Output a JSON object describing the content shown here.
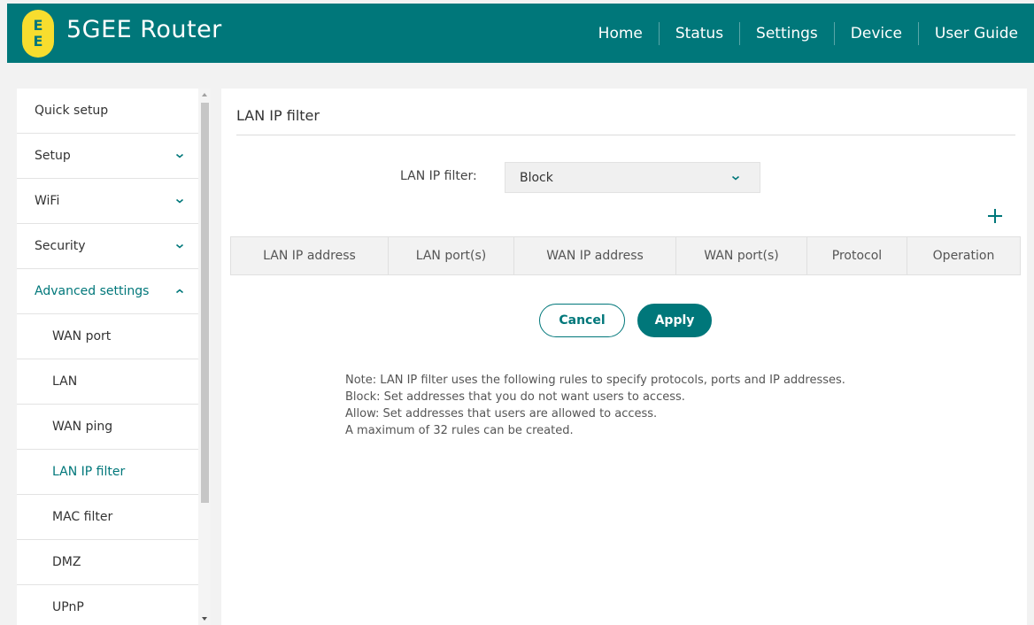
{
  "header": {
    "logo_top": "E",
    "logo_bottom": "E",
    "brand": "5GEE Router",
    "nav": [
      "Home",
      "Status",
      "Settings",
      "Device",
      "User Guide"
    ]
  },
  "sidebar": {
    "items": [
      {
        "label": "Quick setup",
        "chevron": ""
      },
      {
        "label": "Setup",
        "chevron": "chevron-down"
      },
      {
        "label": "WiFi",
        "chevron": "chevron-down"
      },
      {
        "label": "Security",
        "chevron": "chevron-down"
      },
      {
        "label": "Advanced settings",
        "chevron": "chevron-up"
      }
    ],
    "subitems": [
      {
        "label": "WAN port"
      },
      {
        "label": "LAN"
      },
      {
        "label": "WAN ping"
      },
      {
        "label": "LAN IP filter"
      },
      {
        "label": "MAC filter"
      },
      {
        "label": "DMZ"
      },
      {
        "label": "UPnP"
      }
    ],
    "active_subitem": "LAN IP filter"
  },
  "main": {
    "title": "LAN IP filter",
    "filter_label": "LAN IP filter:",
    "filter_value": "Block",
    "table": {
      "columns": [
        "LAN IP address",
        "LAN port(s)",
        "WAN IP address",
        "WAN port(s)",
        "Protocol",
        "Operation"
      ],
      "rows": []
    },
    "cancel_label": "Cancel",
    "apply_label": "Apply",
    "notes": [
      "Note: LAN IP filter uses the following rules to specify protocols, ports and IP addresses.",
      "Block: Set addresses that you do not want users to access.",
      "Allow: Set addresses that users are allowed to access.",
      "A maximum of 32 rules can be created."
    ]
  },
  "colors": {
    "brand_teal": "#00777a",
    "logo_yellow": "#f7dd2e"
  }
}
